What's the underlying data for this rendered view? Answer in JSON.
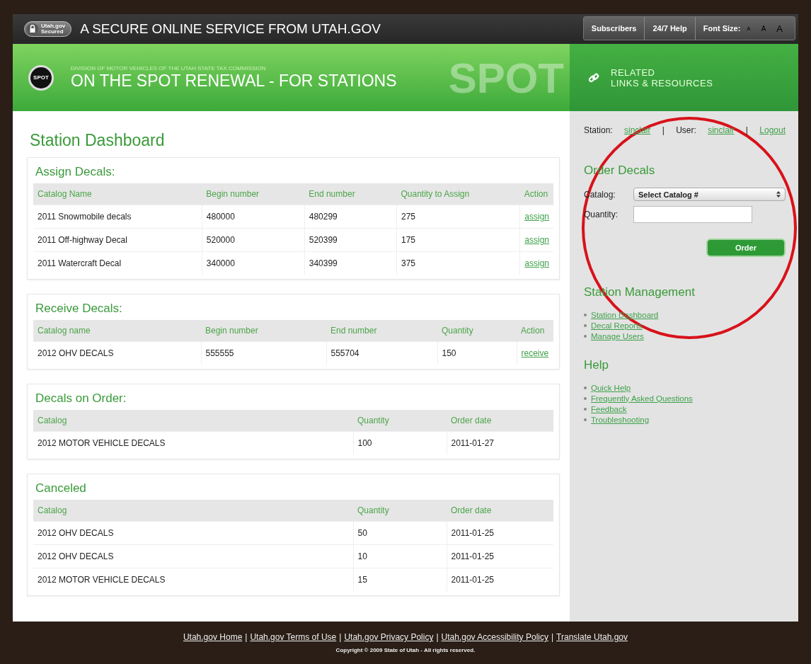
{
  "header": {
    "secured_badge": [
      "Utah.gov",
      "Secured"
    ],
    "title": "A SECURE ONLINE SERVICE FROM UTAH.GOV",
    "buttons": [
      "Subscribers",
      "24/7 Help"
    ],
    "font_size": {
      "label": "Font Size:",
      "letters": [
        "A",
        "A",
        "A"
      ]
    }
  },
  "banner": {
    "logo": "SPOT",
    "division": "DIVISION OF MOTOR VEHICLES OF THE UTAH STATE TAX COMMISSION",
    "title": "ON THE SPOT RENEWAL - FOR STATIONS",
    "watermark": "SPOT",
    "related": [
      "RELATED",
      "LINKS & RESOURCES"
    ]
  },
  "page_title": "Station Dashboard",
  "sections": [
    {
      "title": "Assign Decals:",
      "columns": [
        "Catalog Name",
        "Begin number",
        "End number",
        "Quantity to Assign",
        "Action"
      ],
      "rows": [
        {
          "cells": [
            "2011 Snowmobile decals",
            "480000",
            "480299",
            "275"
          ],
          "action": "assign"
        },
        {
          "cells": [
            "2011 Off-highway Decal",
            "520000",
            "520399",
            "175"
          ],
          "action": "assign"
        },
        {
          "cells": [
            "2011 Watercraft Decal",
            "340000",
            "340399",
            "375"
          ],
          "action": "assign"
        }
      ]
    },
    {
      "title": "Receive Decals:",
      "columns": [
        "Catalog name",
        "Begin number",
        "End number",
        "Quantity",
        "Action"
      ],
      "rows": [
        {
          "cells": [
            "2012 OHV DECALS",
            "555555",
            "555704",
            "150"
          ],
          "action": "receive"
        }
      ]
    },
    {
      "title": "Decals on Order:",
      "columns": [
        "Catalog",
        "Quantity",
        "Order date"
      ],
      "rows": [
        {
          "cells": [
            "2012 MOTOR VEHICLE DECALS",
            "100",
            "2011-01-27"
          ]
        }
      ]
    },
    {
      "title": "Canceled",
      "columns": [
        "Catalog",
        "Quantity",
        "Order date"
      ],
      "rows": [
        {
          "cells": [
            "2012 OHV DECALS",
            "50",
            "2011-01-25"
          ]
        },
        {
          "cells": [
            "2012 OHV DECALS",
            "10",
            "2011-01-25"
          ]
        },
        {
          "cells": [
            "2012 MOTOR VEHICLE DECALS",
            "15",
            "2011-01-25"
          ]
        }
      ]
    }
  ],
  "sidebar": {
    "session": {
      "station_label": "Station:",
      "station": "sinclair",
      "separator": "|",
      "user_label": "User:",
      "user": "sinclair",
      "logout": "Logout"
    },
    "order_decals": {
      "title": "Order Decals",
      "catalog_label": "Catalog:",
      "catalog_value": "Select Catalog #",
      "quantity_label": "Quantity:",
      "button": "Order"
    },
    "menus": [
      {
        "title": "Station Management",
        "links": [
          "Station Dashboard",
          "Decal Reports",
          "Manage Users"
        ]
      },
      {
        "title": "Help",
        "links": [
          "Quick Help",
          "Frequently Asked Questions",
          "Feedback",
          "Troubleshooting"
        ]
      }
    ]
  },
  "footer": {
    "separator": "|",
    "links": [
      "Utah.gov Home",
      "Utah.gov Terms of Use",
      "Utah.gov Privacy Policy",
      "Utah.gov Accessibility Policy",
      "Translate Utah.gov"
    ],
    "copyright": "Copyright © 2009 State of Utah - All rights reserved."
  }
}
